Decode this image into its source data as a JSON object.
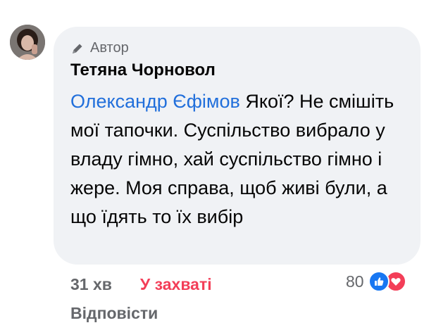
{
  "comment": {
    "author_badge": "Автор",
    "author_name": "Тетяна Чорновол",
    "mention": "Олександр Єфімов",
    "text": " Якої? Не смішіть мої тапочки. Суспільство вибрало у владу гімно, хай суспільство гімно і жере. Моя справа, щоб живі були, а що їдять то їх вибір",
    "time": "31 хв",
    "reaction_label": "У захваті",
    "reaction_count": "80",
    "reply_label": "Відповісти",
    "reaction_icons": [
      "like-icon",
      "love-icon"
    ],
    "colors": {
      "bubble": "#f0f2f5",
      "mention": "#216fdb",
      "reaction_label": "#f33e58",
      "like": "#1877f2",
      "love": "#f33e58",
      "meta_text": "#65676b"
    }
  }
}
